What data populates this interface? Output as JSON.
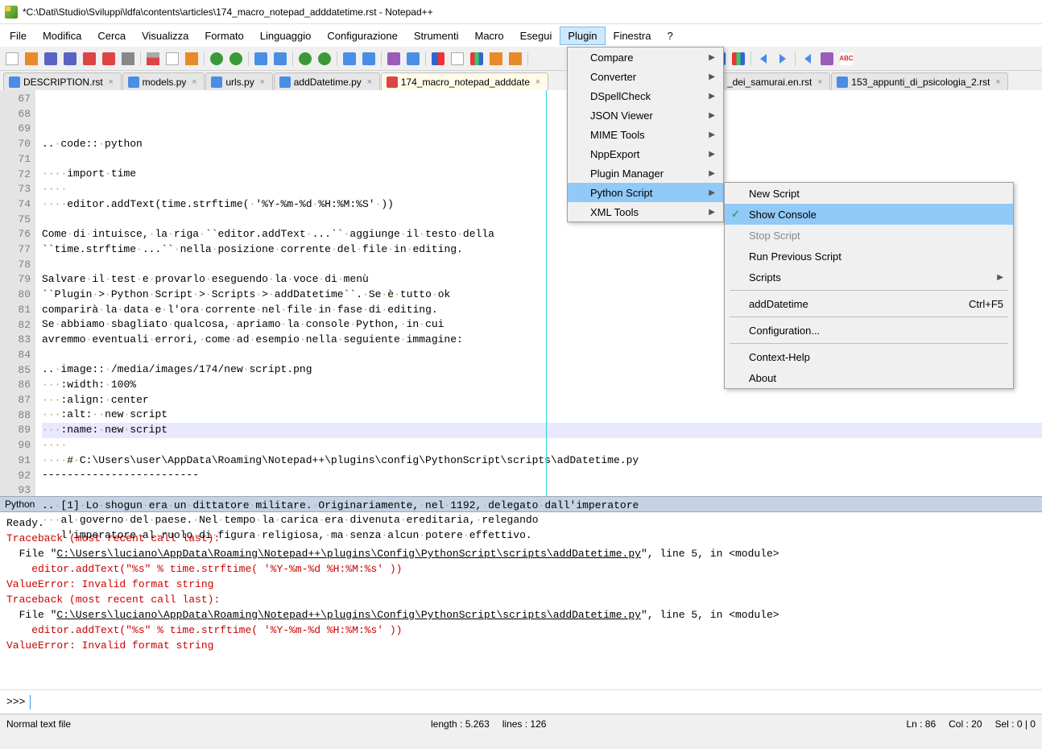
{
  "window": {
    "title": "*C:\\Dati\\Studio\\Sviluppi\\ldfa\\contents\\articles\\174_macro_notepad_adddatetime.rst - Notepad++"
  },
  "menu": [
    "File",
    "Modifica",
    "Cerca",
    "Visualizza",
    "Formato",
    "Linguaggio",
    "Configurazione",
    "Strumenti",
    "Macro",
    "Esegui",
    "Plugin",
    "Finestra",
    "?"
  ],
  "menu_active": "Plugin",
  "plugin_menu": [
    "Compare",
    "Converter",
    "DSpellCheck",
    "JSON Viewer",
    "MIME Tools",
    "NppExport",
    "Plugin Manager",
    "Python Script",
    "XML Tools"
  ],
  "plugin_menu_hl": "Python Script",
  "python_submenu": {
    "items": [
      {
        "label": "New Script",
        "type": "item"
      },
      {
        "label": "Show Console",
        "type": "item",
        "checked": true,
        "hl": true
      },
      {
        "label": "Stop Script",
        "type": "item",
        "disabled": true
      },
      {
        "label": "Run Previous Script",
        "type": "item"
      },
      {
        "label": "Scripts",
        "type": "sub"
      },
      {
        "type": "sep"
      },
      {
        "label": "addDatetime",
        "type": "item",
        "shortcut": "Ctrl+F5"
      },
      {
        "type": "sep"
      },
      {
        "label": "Configuration...",
        "type": "item"
      },
      {
        "type": "sep"
      },
      {
        "label": "Context-Help",
        "type": "item"
      },
      {
        "label": "About",
        "type": "item"
      }
    ]
  },
  "tabs": [
    {
      "label": "DESCRIPTION.rst"
    },
    {
      "label": "models.py"
    },
    {
      "label": "urls.py"
    },
    {
      "label": "addDatetime.py"
    },
    {
      "label": "174_macro_notepad_adddate",
      "active": true
    },
    {
      "label": "_dei_samurai.en.rst"
    },
    {
      "label": "153_appunti_di_psicologia_2.rst"
    }
  ],
  "code": {
    "start": 67,
    "current": 86,
    "lines": [
      ".. code:: python",
      "",
      "    import time",
      "    ",
      "    editor.addText(time.strftime( '%Y-%m-%d %H:%M:%S' ))",
      "",
      "Come di intuisce, la riga ``editor.addText ...`` aggiunge il testo della",
      "``time.strftime ...`` nella posizione corrente del file in editing.",
      "",
      "Salvare il test e provarlo eseguendo la voce di menù",
      "``Plugin > Python Script > Scripts > addDatetime``. Se è tutto ok",
      "comparirà la data e l'ora corrente nel file in fase di editing.",
      "Se abbiamo sbagliato qualcosa, apriamo la console Python, in cui",
      "avremmo eventuali errori, come ad esempio nella seguiente immagine:",
      "",
      ".. image:: /media/images/174/new script.png",
      "   :width: 100%",
      "   :align: center",
      "   :alt:  new script",
      "   :name: new script",
      "    ",
      "    # C:\\Users\\user\\AppData\\Roaming\\Notepad++\\plugins\\config\\PythonScript\\scripts\\adDatetime.py",
      "-------------------------",
      "",
      ".. [1] Lo shogun era un dittatore militare. Originariamente, nel 1192, delegato dall'imperatore",
      "   al governo del paese. Nel tempo la carica era divenuta ereditaria, relegando",
      "   l'imperatore al ruolo di figura religiosa, ma senza alcun potere effettivo."
    ]
  },
  "console": {
    "title": "Python",
    "lines": [
      {
        "t": "Ready.",
        "c": "c-black"
      },
      {
        "t": "Traceback (most recent call last):",
        "c": "c-red"
      },
      {
        "t": "  File \"",
        "c": "c-black",
        "append": [
          {
            "t": "C:\\Users\\luciano\\AppData\\Roaming\\Notepad++\\plugins\\Config\\PythonScript\\scripts\\addDatetime.py",
            "c": "c-black c-u"
          },
          {
            "t": "\", line 5, in <module>",
            "c": "c-black"
          }
        ]
      },
      {
        "t": "    editor.addText(\"%s\" % time.strftime( '%Y-%m-%d %H:%M:%s' ))",
        "c": "c-red"
      },
      {
        "t": "ValueError: Invalid format string",
        "c": "c-red"
      },
      {
        "t": "Traceback (most recent call last):",
        "c": "c-red"
      },
      {
        "t": "  File \"",
        "c": "c-black",
        "append": [
          {
            "t": "C:\\Users\\luciano\\AppData\\Roaming\\Notepad++\\plugins\\Config\\PythonScript\\scripts\\addDatetime.py",
            "c": "c-black c-u"
          },
          {
            "t": "\", line 5, in <module>",
            "c": "c-black"
          }
        ]
      },
      {
        "t": "    editor.addText(\"%s\" % time.strftime( '%Y-%m-%d %H:%M:%s' ))",
        "c": "c-red"
      },
      {
        "t": "ValueError: Invalid format string",
        "c": "c-red"
      }
    ],
    "prompt": ">>>"
  },
  "status": {
    "left": "Normal text file",
    "mid1": "length : 5.263",
    "mid2": "lines : 126",
    "right1": "Ln : 86",
    "right2": "Col : 20",
    "right3": "Sel : 0 | 0"
  }
}
